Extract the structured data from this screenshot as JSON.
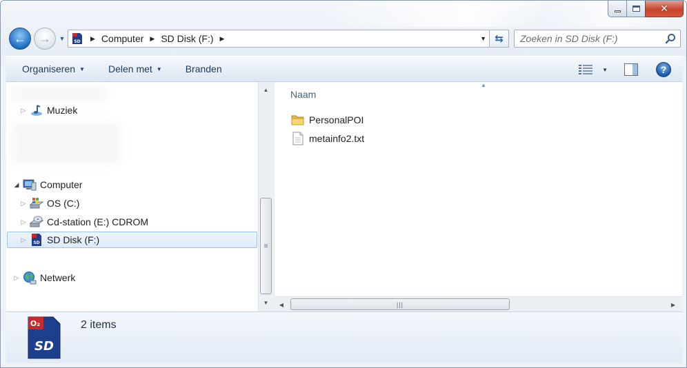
{
  "window": {
    "caption": {
      "minimize": "",
      "maximize": "",
      "close": "✕"
    }
  },
  "nav": {
    "back": "back-arrow",
    "forward": "forward-arrow"
  },
  "address": {
    "crumbs": [
      "Computer",
      "SD Disk (F:)"
    ]
  },
  "search": {
    "placeholder": "Zoeken in SD Disk (F:)",
    "value": ""
  },
  "toolbar": {
    "organise": "Organiseren",
    "share": "Delen met",
    "burn": "Branden",
    "help": "?"
  },
  "navpane": {
    "items": [
      {
        "label": "Muziek",
        "icon": "music-icon",
        "expanded": false
      },
      {
        "label": "Computer",
        "icon": "computer-icon",
        "expanded": true
      },
      {
        "label": "OS (C:)",
        "icon": "drive-os-icon",
        "expanded": false
      },
      {
        "label": "Cd-station (E:) CDROM",
        "icon": "cdrom-icon",
        "expanded": false
      },
      {
        "label": "SD Disk (F:)",
        "icon": "sd-card-icon",
        "expanded": false,
        "selected": true
      },
      {
        "label": "Netwerk",
        "icon": "network-icon",
        "expanded": false
      }
    ]
  },
  "filelist": {
    "column_name": "Naam",
    "files": [
      {
        "name": "PersonalPOI",
        "type": "folder"
      },
      {
        "name": "metainfo2.txt",
        "type": "text-file"
      }
    ]
  },
  "details": {
    "count": "2 items"
  },
  "colors": {
    "accent": "#1f6fc5",
    "selection": "#dceaf9",
    "toolbar_text": "#1e395b"
  }
}
